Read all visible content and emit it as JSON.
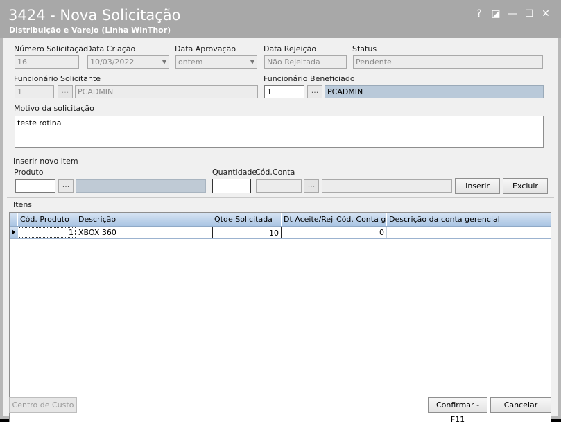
{
  "window": {
    "title": "3424 - Nova Solicitação",
    "subtitle": "Distribuição e Varejo (Linha WinThor)",
    "controls": {
      "help": "?",
      "restore": "◪",
      "minimize": "—",
      "maximize": "☐",
      "close": "✕"
    }
  },
  "header": {
    "numero_label": "Número Solicitação",
    "numero_value": "16",
    "criacao_label": "Data Criação",
    "criacao_value": "10/03/2022",
    "aprovacao_label": "Data Aprovação",
    "aprovacao_value": "ontem",
    "rejeicao_label": "Data Rejeição",
    "rejeicao_value": "Não Rejeitada",
    "status_label": "Status",
    "status_value": "Pendente",
    "solicitante_label": "Funcionário Solicitante",
    "solicitante_code": "1",
    "solicitante_name": "PCADMIN",
    "beneficiado_label": "Funcionário Beneficiado",
    "beneficiado_code": "1",
    "beneficiado_name": "PCADMIN",
    "ellipsis": "...",
    "motivo_label": "Motivo da solicitação",
    "motivo_value": "teste rotina"
  },
  "insert": {
    "section_label": "Inserir novo item",
    "produto_label": "Produto",
    "produto_value": "",
    "quantidade_label": "Quantidade",
    "quantidade_value": "",
    "conta_label": "Cód.Conta",
    "inserir_button": "Inserir",
    "excluir_button": "Excluir"
  },
  "items": {
    "section_label": "Itens",
    "columns": [
      "Cód. Produto",
      "Descrição",
      "Qtde Solicitada",
      "Dt Aceite/Reje",
      "Cód. Conta ge",
      "Descrição da conta gerencial"
    ],
    "rows": [
      {
        "cod_produto": "1",
        "descricao": "XBOX 360",
        "qtde": "10",
        "dt_aceite": "",
        "cod_conta": "0",
        "desc_conta": ""
      }
    ]
  },
  "footer": {
    "centro_custo_button": "Centro de Custo",
    "confirmar_button": "Confirmar - F11",
    "cancelar_button": "Cancelar"
  }
}
